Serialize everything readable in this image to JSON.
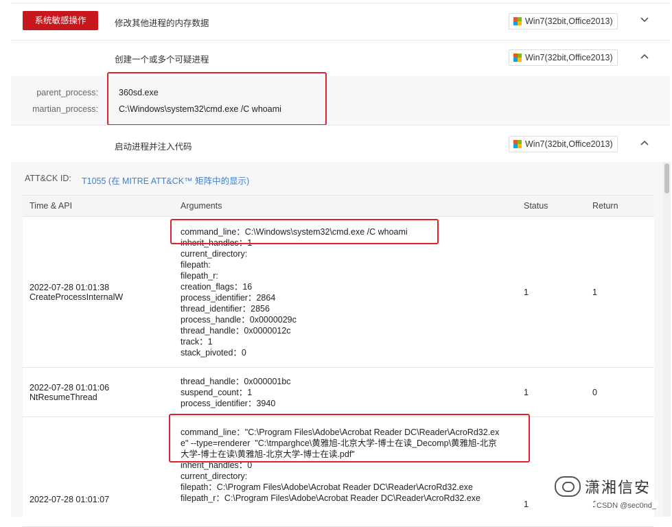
{
  "tag_button": "系统敏感操作",
  "signatures": [
    {
      "title": "修改其他进程的内存数据",
      "os": "Win7(32bit,Office2013)",
      "chevron": "⌄"
    },
    {
      "title": "创建一个或多个可疑进程",
      "os": "Win7(32bit,Office2013)",
      "chevron": "⌃"
    },
    {
      "title": "启动进程并注入代码",
      "os": "Win7(32bit,Office2013)",
      "chevron": "⌃"
    }
  ],
  "process_details": [
    {
      "key": "parent_process:",
      "value": "360sd.exe"
    },
    {
      "key": "martian_process:",
      "value": "C:\\Windows\\system32\\cmd.exe /C whoami"
    }
  ],
  "attck": {
    "label": "ATT&CK ID:",
    "link": "T1055 (在 MITRE ATT&CK™ 矩阵中的显示)"
  },
  "table": {
    "headers": [
      "Time & API",
      "Arguments",
      "Status",
      "Return"
    ],
    "rows": [
      {
        "time": "2022-07-28 01:01:38",
        "api": "CreateProcessInternalW",
        "args": [
          "command_line：C:\\Windows\\system32\\cmd.exe /C whoami",
          "inherit_handles：1",
          "current_directory:",
          "filepath:",
          "filepath_r:",
          "creation_flags：16",
          "process_identifier：2864",
          "thread_identifier：2856",
          "process_handle：0x0000029c",
          "thread_handle：0x0000012c",
          "track：1",
          "stack_pivoted：0"
        ],
        "status": "1",
        "return": "1"
      },
      {
        "time": "2022-07-28 01:01:06",
        "api": "NtResumeThread",
        "args": [
          "thread_handle：0x000001bc",
          "suspend_count：1",
          "process_identifier：3940"
        ],
        "status": "1",
        "return": "0"
      },
      {
        "time": "2022-07-28 01:01:07",
        "api": "",
        "args": [
          "command_line：\"C:\\Program Files\\Adobe\\Acrobat Reader DC\\Reader\\AcroRd32.ex",
          "e\" --type=renderer  \"C:\\tmparghce\\黄雅旭-北京大学-博士在读_Decomp\\黄雅旭-北京",
          "大学-博士在读\\黄雅旭-北京大学-博士在读.pdf\"",
          "inherit_handles：0",
          "current_directory:",
          "filepath：C:\\Program Files\\Adobe\\Acrobat Reader DC\\Reader\\AcroRd32.exe",
          "filepath_r：C:\\Program Files\\Adobe\\Acrobat Reader DC\\Reader\\AcroRd32.exe"
        ],
        "status": "1",
        "return": "1"
      }
    ]
  },
  "watermark": "潇湘信安",
  "csdn": "CSDN @sec0nd_",
  "colors": {
    "tag_red": "#c8161d",
    "highlight_red": "#e0202a",
    "link_blue": "#3f7fcf"
  }
}
